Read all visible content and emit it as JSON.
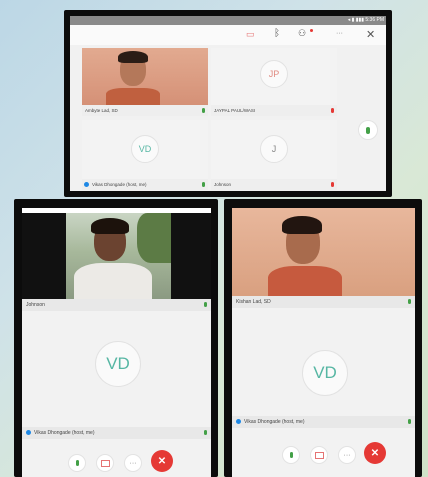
{
  "top_panel": {
    "status_bar": {
      "time": "5:36 PM",
      "signal": "◂ ▮ ▮▮▮"
    },
    "toolbar": {
      "camera_icon": "camera-off-icon",
      "bluetooth_icon": "bluetooth-icon",
      "people_icon": "people-icon",
      "more": "···",
      "close": "✕"
    },
    "tiles": [
      {
        "name": "Ambyte Lad, SD",
        "mic": "on",
        "initials": ""
      },
      {
        "name": "JAYPAL PAUL/WASI",
        "mic": "muted",
        "initials": "JP"
      },
      {
        "name": "Vikas Dhongade (host, me)",
        "mic": "on",
        "initials": "VD"
      },
      {
        "name": "Johnson",
        "mic": "muted",
        "initials": "J"
      }
    ]
  },
  "left_panel": {
    "video_name": "Johnson",
    "avatar_initials": "VD",
    "self_name": "Vikas Dhongade (host, me)",
    "controls": {
      "mic": "🎙",
      "camera": "📷",
      "more": "···",
      "end": "✕"
    }
  },
  "right_panel": {
    "video_name": "Kishan Lad, SD",
    "avatar_initials": "VD",
    "self_name": "Vikas Dhongade (host, me)",
    "controls": {
      "mic": "🎙",
      "camera": "📷",
      "more": "···",
      "end": "✕"
    }
  }
}
